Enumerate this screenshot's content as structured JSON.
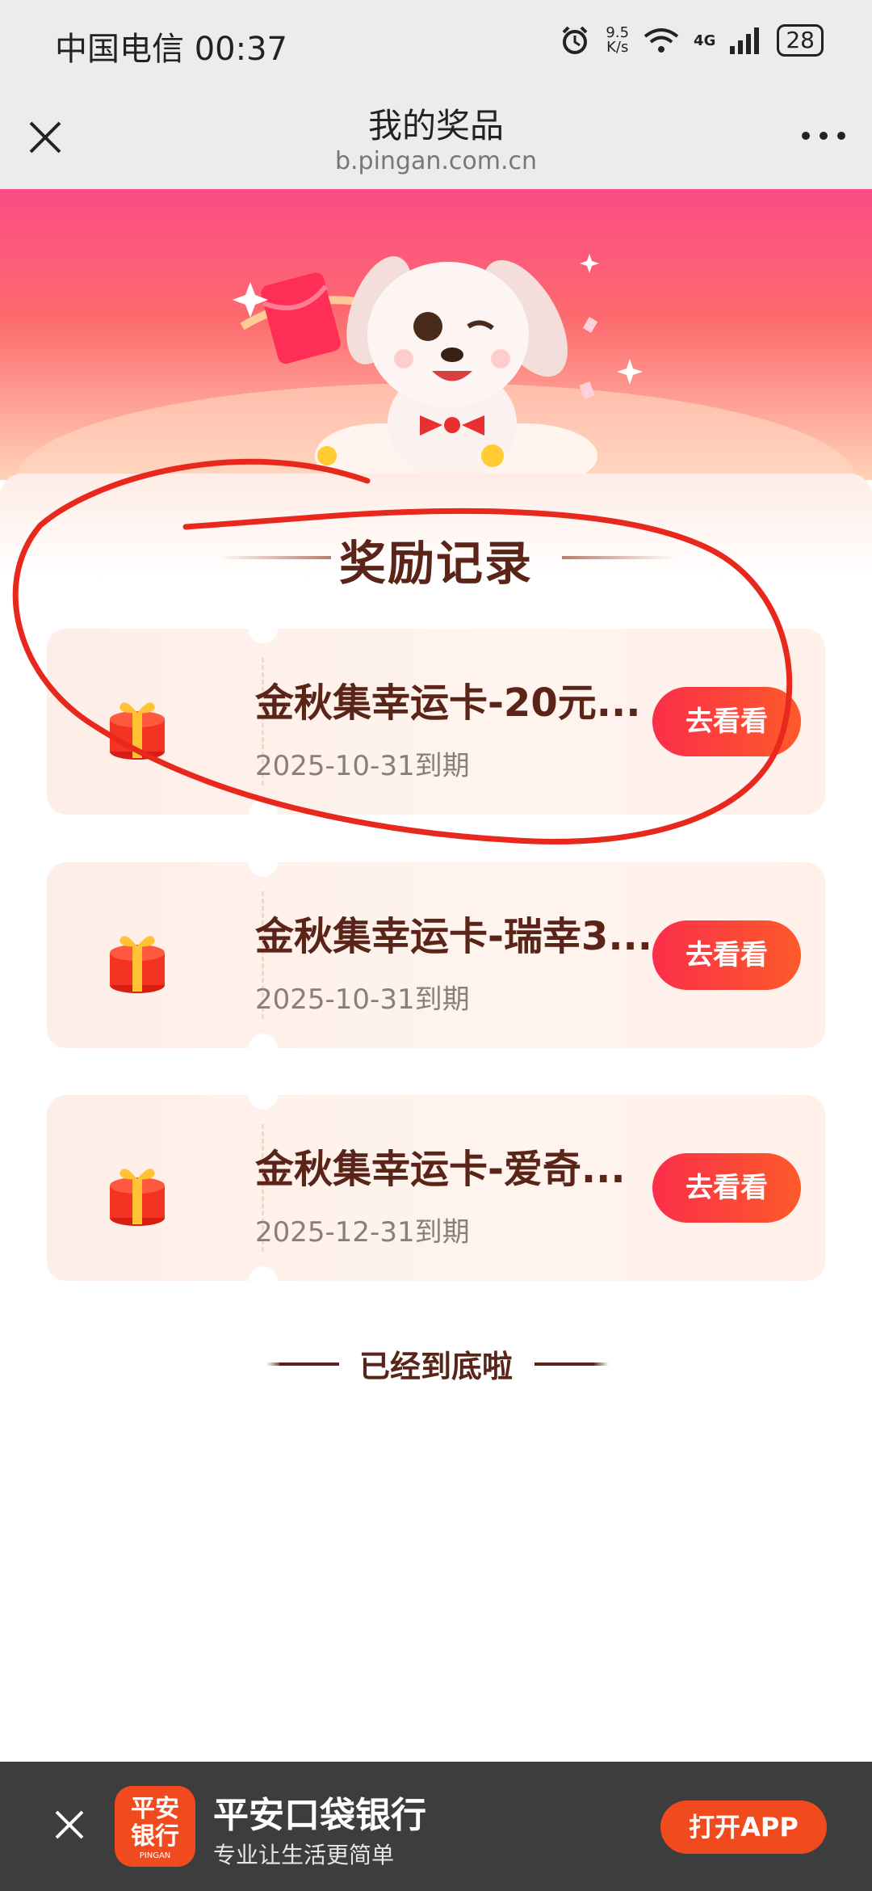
{
  "status_bar": {
    "carrier_time": "中国电信 00:37",
    "net_speed_top": "9.5",
    "net_speed_bottom": "K/s",
    "network": "4G",
    "battery": "28"
  },
  "title_bar": {
    "title": "我的奖品",
    "url": "b.pingan.com.cn"
  },
  "section": {
    "title": "奖励记录"
  },
  "rewards": [
    {
      "name": "金秋集幸运卡-20元...",
      "expire": "2025-10-31到期",
      "button": "去看看"
    },
    {
      "name": "金秋集幸运卡-瑞幸3...",
      "expire": "2025-10-31到期",
      "button": "去看看"
    },
    {
      "name": "金秋集幸运卡-爱奇...",
      "expire": "2025-12-31到期",
      "button": "去看看"
    }
  ],
  "end_note": "已经到底啦",
  "app_banner": {
    "logo_line1": "平安",
    "logo_line2": "银行",
    "logo_small": "PINGAN",
    "app_name": "平安口袋银行",
    "slogan": "专业让生活更简单",
    "open_button": "打开APP"
  },
  "colors": {
    "accent": "#fb2e4a",
    "title_text": "#5a2418",
    "app_orange": "#f24a1f"
  }
}
